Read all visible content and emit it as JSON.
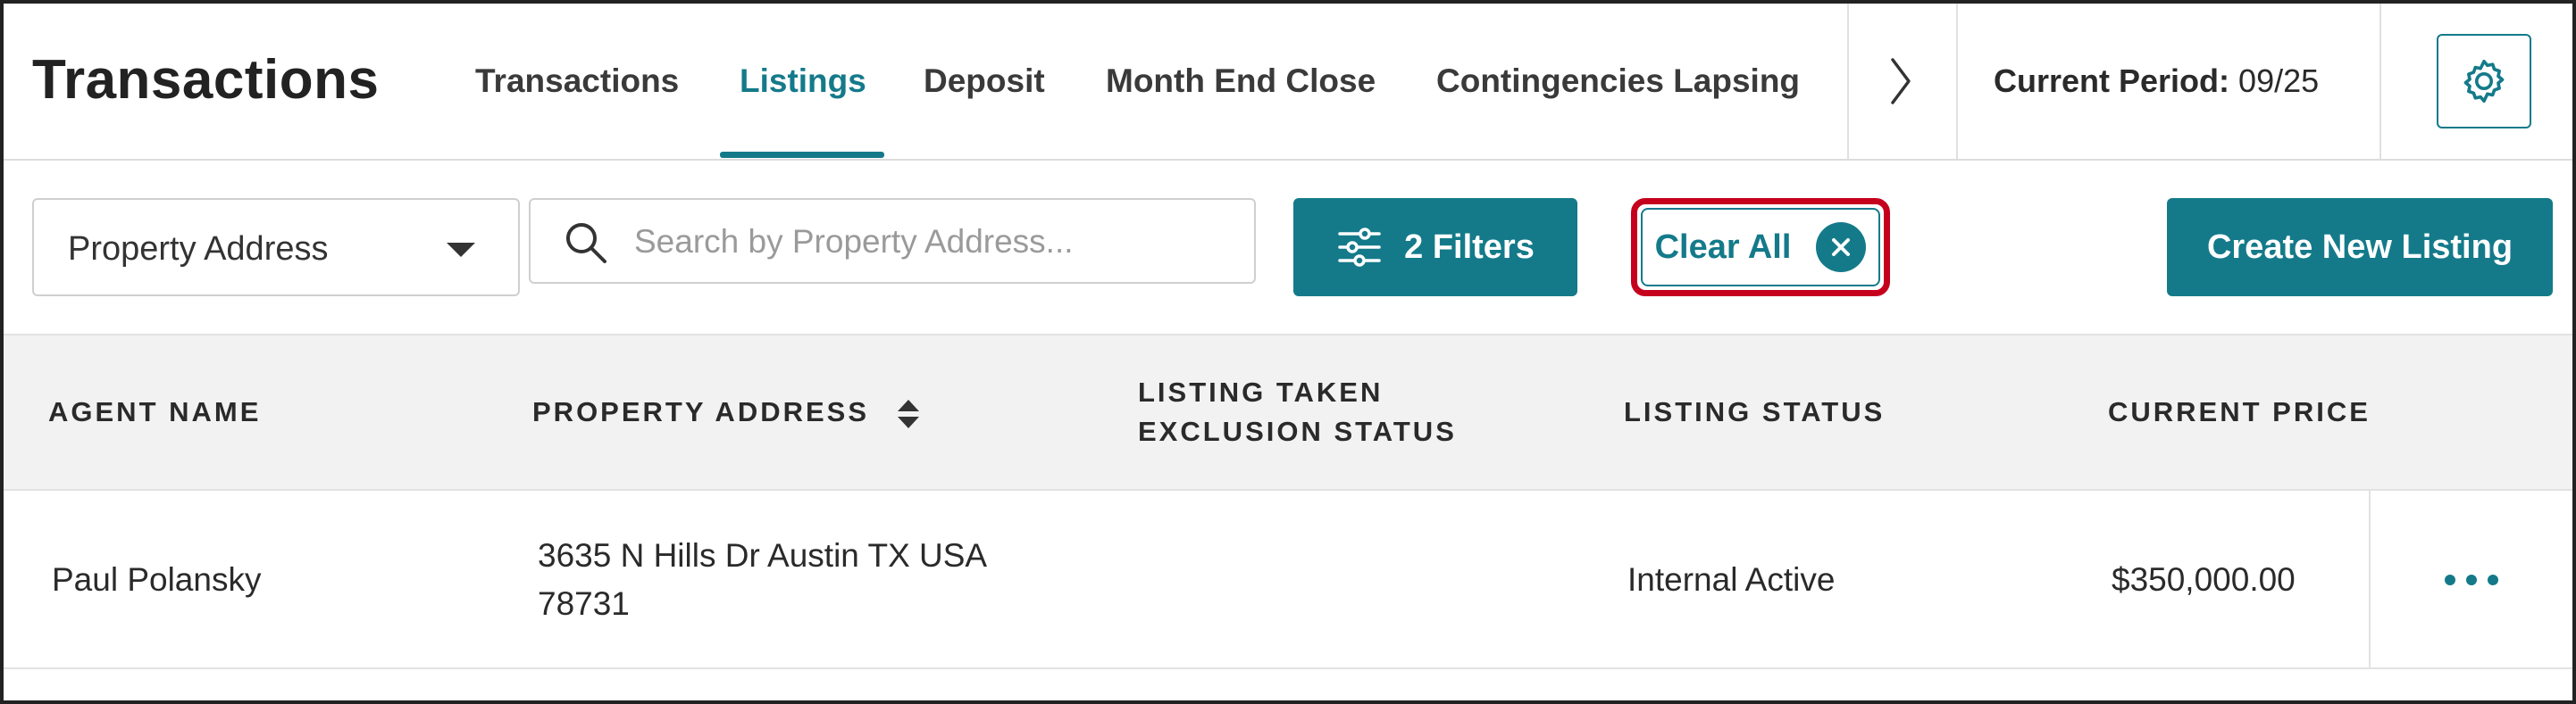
{
  "header": {
    "app_title": "Transactions",
    "tabs": [
      {
        "label": "Transactions",
        "active": false
      },
      {
        "label": "Listings",
        "active": true
      },
      {
        "label": "Deposit",
        "active": false
      },
      {
        "label": "Month End Close",
        "active": false
      },
      {
        "label": "Contingencies Lapsing",
        "active": false
      }
    ],
    "period_label": "Current Period:",
    "period_value": "09/25"
  },
  "toolbar": {
    "search_field_select": "Property Address",
    "search_placeholder": "Search by Property Address...",
    "filters_label": "2 Filters",
    "clear_all_label": "Clear All",
    "create_label": "Create New Listing"
  },
  "table": {
    "columns": [
      {
        "label": "AGENT NAME"
      },
      {
        "label": "PROPERTY ADDRESS",
        "sortable": true
      },
      {
        "label_line1": "LISTING TAKEN",
        "label_line2": "EXCLUSION STATUS"
      },
      {
        "label": "LISTING STATUS"
      },
      {
        "label": "CURRENT PRICE"
      }
    ],
    "rows": [
      {
        "agent_name": "Paul Polansky",
        "address_line1": "3635 N Hills Dr Austin TX USA",
        "address_line2": "78731",
        "exclusion_status": "",
        "listing_status": "Internal Active",
        "current_price": "$350,000.00"
      }
    ]
  },
  "colors": {
    "accent": "#147a8a",
    "highlight": "#c4001d",
    "header_bg": "#f2f2f2"
  },
  "icons": {
    "more": "more-horizontal-icon",
    "settings": "gear-icon",
    "next": "chevron-right-icon",
    "search": "search-icon",
    "filters": "sliders-icon",
    "clear": "close-circle-icon",
    "sort": "sort-icon",
    "select": "caret-down-icon"
  }
}
